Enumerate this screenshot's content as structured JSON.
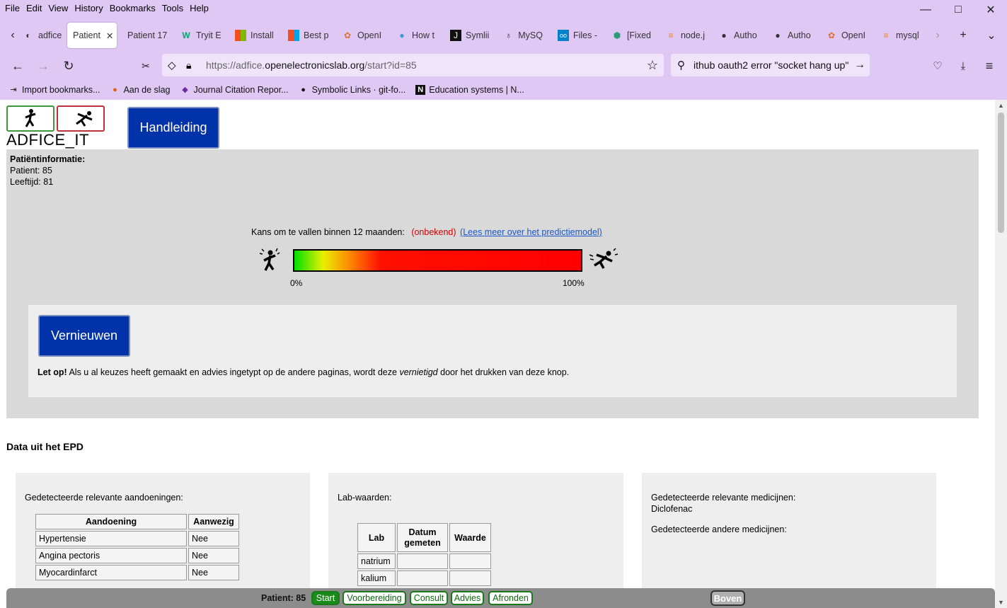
{
  "menu": [
    "File",
    "Edit",
    "View",
    "History",
    "Bookmarks",
    "Tools",
    "Help"
  ],
  "tabs": [
    {
      "label": "adfice",
      "icon": "adfice-icon"
    },
    {
      "label": "Patient",
      "icon": "",
      "active": true
    },
    {
      "label": "Patient 17",
      "icon": ""
    },
    {
      "label": "Tryit E",
      "icon": "w3-icon"
    },
    {
      "label": "Install",
      "icon": "windows-icon"
    },
    {
      "label": "Best p",
      "icon": "windows-icon"
    },
    {
      "label": "OpenI",
      "icon": "openai-icon"
    },
    {
      "label": "How t",
      "icon": "site-icon"
    },
    {
      "label": "Symlii",
      "icon": "site-icon"
    },
    {
      "label": "MySQ",
      "icon": "site-icon"
    },
    {
      "label": "Files -",
      "icon": "nextcloud-icon"
    },
    {
      "label": "[Fixed",
      "icon": "site-icon"
    },
    {
      "label": "node.j",
      "icon": "stackoverflow-icon"
    },
    {
      "label": "Autho",
      "icon": "github-icon"
    },
    {
      "label": "Autho",
      "icon": "github-icon"
    },
    {
      "label": "OpenI",
      "icon": "openai-icon"
    },
    {
      "label": "mysql",
      "icon": "stackoverflow-icon"
    }
  ],
  "url": {
    "prefix": "https://adfice.",
    "domain": "openelectronicslab.org",
    "path": "/start?id=85"
  },
  "search": "ithub oauth2 error \"socket hang up\"",
  "bookmarks": [
    "Import bookmarks...",
    "Aan de slag",
    "Journal Citation Repor...",
    "Symbolic Links · git-fo...",
    "Education systems | N..."
  ],
  "logo_text": "ADFICE_IT",
  "handleiding": "Handleiding",
  "patient_info": {
    "title": "Patiëntinformatie:",
    "patient": "Patient: 85",
    "age": "Leeftijd: 81"
  },
  "risk": {
    "label": "Kans om te vallen binnen 12 maanden:",
    "value": "(onbekend)",
    "link": "(Lees meer over het predictiemodel)",
    "min": "0%",
    "max": "100%"
  },
  "refresh": {
    "button": "Vernieuwen",
    "warn_bold": "Let op!",
    "warn_1": " Als u al keuzes heeft gemaakt en advies ingetypt op de andere paginas, wordt deze ",
    "warn_italic": "vernietigd",
    "warn_2": " door het drukken van deze knop."
  },
  "section_title": "Data uit het EPD",
  "conditions": {
    "caption": "Gedetecteerde relevante aandoeningen:",
    "headers": [
      "Aandoening",
      "Aanwezig"
    ],
    "rows": [
      [
        "Hypertensie",
        "Nee"
      ],
      [
        "Angina pectoris",
        "Nee"
      ],
      [
        "Myocardinfarct",
        "Nee"
      ]
    ]
  },
  "labs": {
    "caption": "Lab-waarden:",
    "headers": [
      "Lab",
      "Datum gemeten",
      "Waarde"
    ],
    "rows": [
      [
        "natrium",
        "",
        ""
      ],
      [
        "kalium",
        "",
        ""
      ]
    ]
  },
  "medicines": {
    "caption1": "Gedetecteerde relevante medicijnen:",
    "item": "Diclofenac",
    "caption2": "Gedetecteerde andere medicijnen:"
  },
  "bottom": {
    "patient": "Patient: 85",
    "steps": [
      "Start",
      "Voorbereiding",
      "Consult",
      "Advies",
      "Afronden"
    ],
    "top": "Boven"
  }
}
